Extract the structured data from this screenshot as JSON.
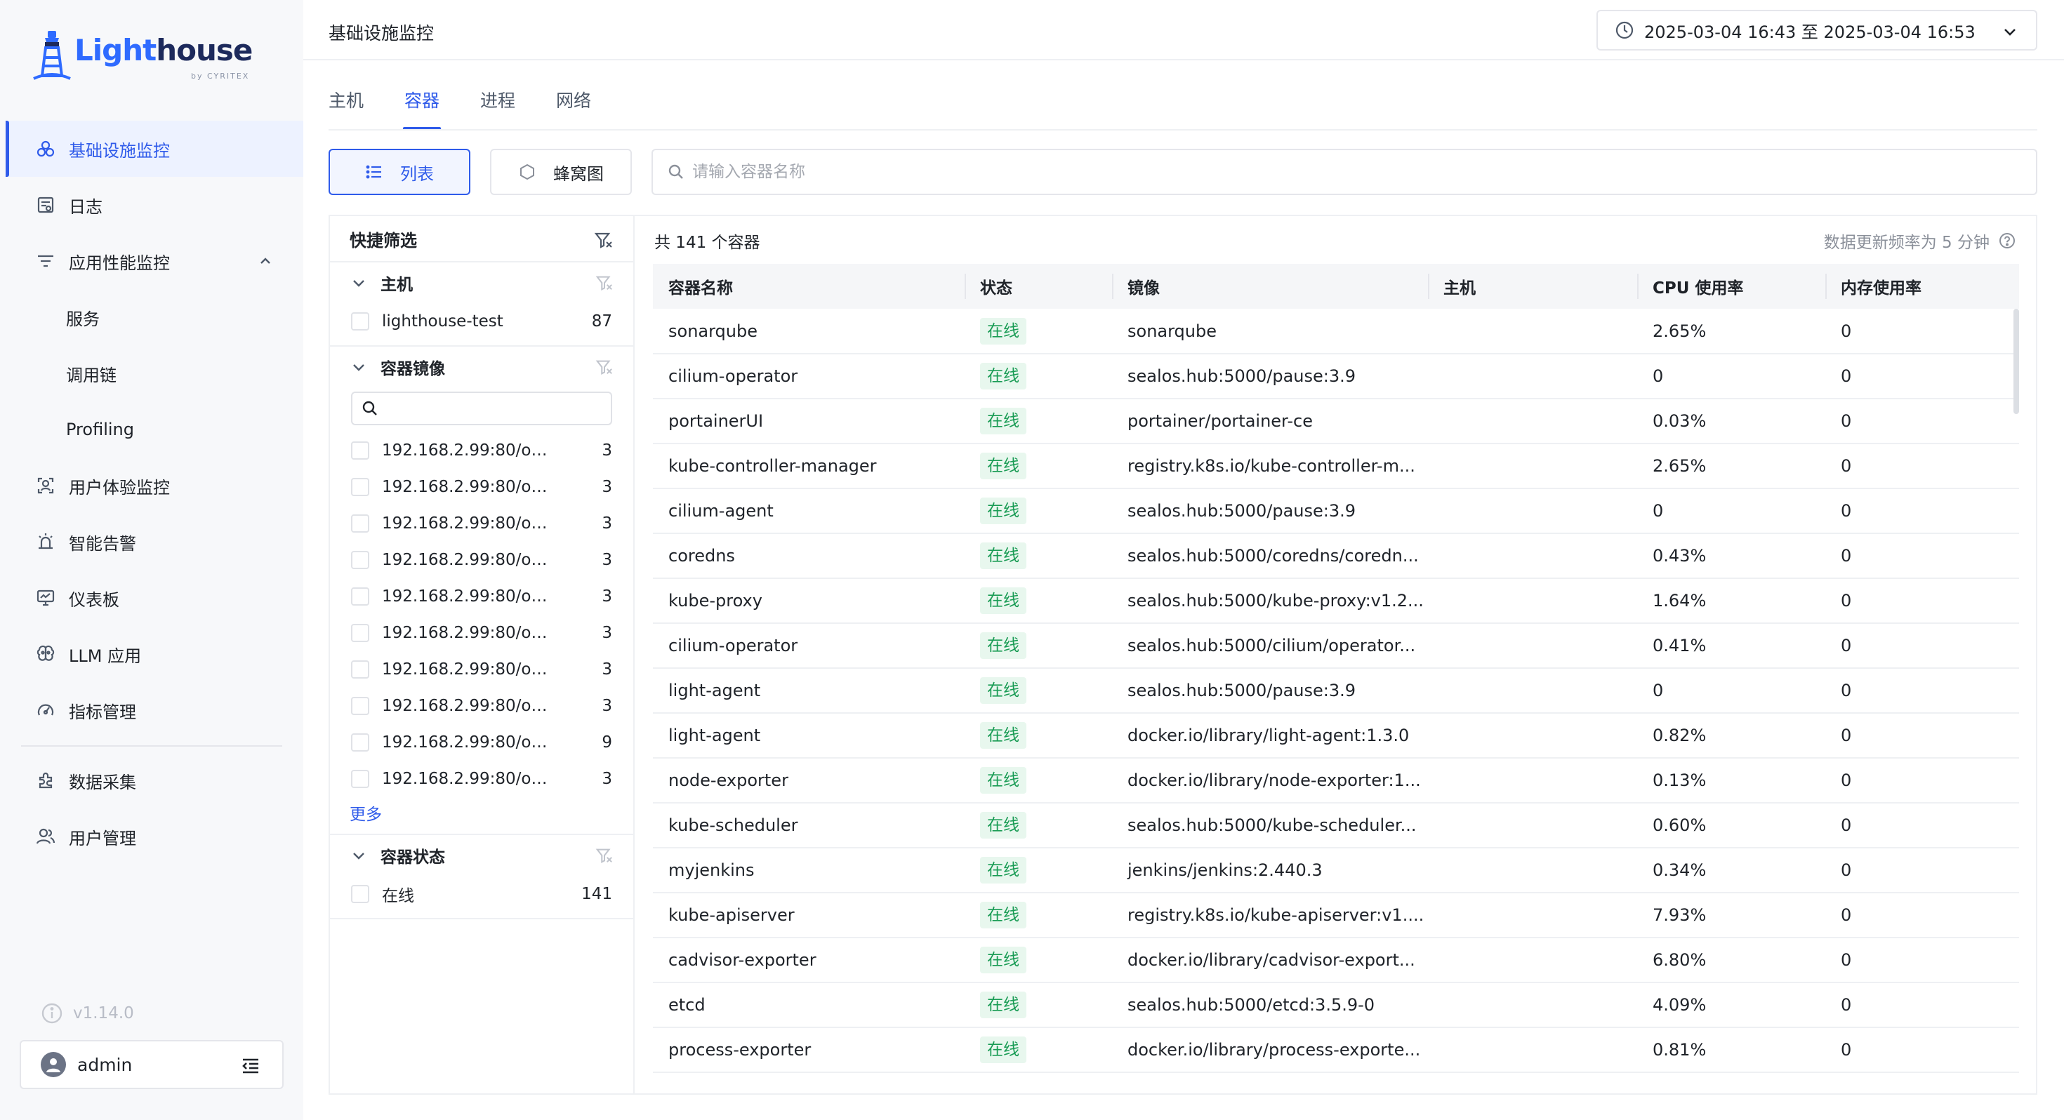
{
  "app": {
    "logo": {
      "word_a": "Light",
      "word_b": "house",
      "sub": "by CYRITEX"
    }
  },
  "sidebar": {
    "items": [
      {
        "key": "infra",
        "label": "基础设施监控",
        "icon": "cluster-icon",
        "active": true
      },
      {
        "key": "logs",
        "label": "日志",
        "icon": "log-icon"
      },
      {
        "key": "apm",
        "label": "应用性能监控",
        "icon": "filter-lines-icon",
        "expanded": true
      }
    ],
    "apm_children": [
      {
        "key": "service",
        "label": "服务"
      },
      {
        "key": "trace",
        "label": "调用链"
      },
      {
        "key": "profiling",
        "label": "Profiling"
      }
    ],
    "items_b": [
      {
        "key": "rum",
        "label": "用户体验监控",
        "icon": "user-scan-icon"
      },
      {
        "key": "alert",
        "label": "智能告警",
        "icon": "alarm-icon"
      },
      {
        "key": "dashboard",
        "label": "仪表板",
        "icon": "monitor-icon"
      },
      {
        "key": "llm",
        "label": "LLM 应用",
        "icon": "brain-icon"
      },
      {
        "key": "metrics",
        "label": "指标管理",
        "icon": "gauge-icon"
      }
    ],
    "items_c": [
      {
        "key": "collect",
        "label": "数据采集",
        "icon": "plugin-icon"
      },
      {
        "key": "users",
        "label": "用户管理",
        "icon": "users-icon"
      }
    ],
    "version": "v1.14.0",
    "user": "admin"
  },
  "header": {
    "title": "基础设施监控",
    "time_range": "2025-03-04 16:43 至 2025-03-04 16:53"
  },
  "tabs": [
    {
      "label": "主机",
      "active": false
    },
    {
      "label": "容器",
      "active": true
    },
    {
      "label": "进程",
      "active": false
    },
    {
      "label": "网络",
      "active": false
    }
  ],
  "view": {
    "list_label": "列表",
    "hive_label": "蜂窝图",
    "search_placeholder": "请输入容器名称"
  },
  "filter": {
    "title": "快捷筛选",
    "host_group": {
      "title": "主机",
      "options": [
        {
          "label": "lighthouse-test",
          "count": "87"
        }
      ]
    },
    "image_group": {
      "title": "容器镜像",
      "options": [
        {
          "label": "192.168.2.99:80/obs...",
          "count": "3"
        },
        {
          "label": "192.168.2.99:80/obs...",
          "count": "3"
        },
        {
          "label": "192.168.2.99:80/obs...",
          "count": "3"
        },
        {
          "label": "192.168.2.99:80/obs...",
          "count": "3"
        },
        {
          "label": "192.168.2.99:80/obs...",
          "count": "3"
        },
        {
          "label": "192.168.2.99:80/obs...",
          "count": "3"
        },
        {
          "label": "192.168.2.99:80/obs...",
          "count": "3"
        },
        {
          "label": "192.168.2.99:80/obs...",
          "count": "3"
        },
        {
          "label": "192.168.2.99:80/obs...",
          "count": "9"
        },
        {
          "label": "192.168.2.99:80/obs...",
          "count": "3"
        }
      ],
      "more": "更多"
    },
    "status_group": {
      "title": "容器状态",
      "options": [
        {
          "label": "在线",
          "count": "141"
        }
      ]
    }
  },
  "table": {
    "summary": "共 141 个容器",
    "refresh_note": "数据更新频率为 5 分钟",
    "columns": [
      "容器名称",
      "状态",
      "镜像",
      "主机",
      "CPU 使用率",
      "内存使用率"
    ],
    "rows": [
      [
        "sonarqube",
        "在线",
        "sonarqube",
        "",
        "2.65%",
        "0"
      ],
      [
        "cilium-operator",
        "在线",
        "sealos.hub:5000/pause:3.9",
        "",
        "0",
        "0"
      ],
      [
        "portainerUI",
        "在线",
        "portainer/portainer-ce",
        "",
        "0.03%",
        "0"
      ],
      [
        "kube-controller-manager",
        "在线",
        "registry.k8s.io/kube-controller-m...",
        "",
        "2.65%",
        "0"
      ],
      [
        "cilium-agent",
        "在线",
        "sealos.hub:5000/pause:3.9",
        "",
        "0",
        "0"
      ],
      [
        "coredns",
        "在线",
        "sealos.hub:5000/coredns/coredn...",
        "",
        "0.43%",
        "0"
      ],
      [
        "kube-proxy",
        "在线",
        "sealos.hub:5000/kube-proxy:v1.2...",
        "",
        "1.64%",
        "0"
      ],
      [
        "cilium-operator",
        "在线",
        "sealos.hub:5000/cilium/operator...",
        "",
        "0.41%",
        "0"
      ],
      [
        "light-agent",
        "在线",
        "sealos.hub:5000/pause:3.9",
        "",
        "0",
        "0"
      ],
      [
        "light-agent",
        "在线",
        "docker.io/library/light-agent:1.3.0",
        "",
        "0.82%",
        "0"
      ],
      [
        "node-exporter",
        "在线",
        "docker.io/library/node-exporter:1...",
        "",
        "0.13%",
        "0"
      ],
      [
        "kube-scheduler",
        "在线",
        "sealos.hub:5000/kube-scheduler...",
        "",
        "0.60%",
        "0"
      ],
      [
        "myjenkins",
        "在线",
        "jenkins/jenkins:2.440.3",
        "",
        "0.34%",
        "0"
      ],
      [
        "kube-apiserver",
        "在线",
        "registry.k8s.io/kube-apiserver:v1....",
        "",
        "7.93%",
        "0"
      ],
      [
        "cadvisor-exporter",
        "在线",
        "docker.io/library/cadvisor-export...",
        "",
        "6.80%",
        "0"
      ],
      [
        "etcd",
        "在线",
        "sealos.hub:5000/etcd:3.5.9-0",
        "",
        "4.09%",
        "0"
      ],
      [
        "process-exporter",
        "在线",
        "docker.io/library/process-exporte...",
        "",
        "0.81%",
        "0"
      ]
    ]
  },
  "colors": {
    "accent": "#2f5bea",
    "online_bg": "#e8f7ee",
    "online_fg": "#1a9c55"
  }
}
